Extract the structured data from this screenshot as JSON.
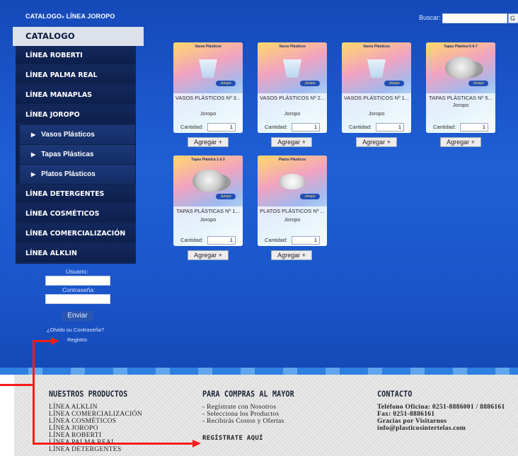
{
  "header": {
    "site_title_prefix": "CATALOGO",
    "site_title_sep": "»",
    "site_title_rest": " LÍNEA JOROPO",
    "search_label": "Buscar:",
    "search_value": "",
    "search_button": "G"
  },
  "sidebar": {
    "title": "CATALOGO",
    "items": [
      {
        "label": "LÍNEA ROBERTI",
        "sub": false
      },
      {
        "label": "LÍNEA PALMA REAL",
        "sub": false
      },
      {
        "label": "LÍNEA MANAPLAS",
        "sub": false
      },
      {
        "label": "LÍNEA JOROPO",
        "sub": false
      },
      {
        "label": "Vasos Plásticos",
        "sub": true
      },
      {
        "label": "Tapas Plásticas",
        "sub": true
      },
      {
        "label": "Platos Plásticos",
        "sub": true
      },
      {
        "label": "LÍNEA DETERGENTES",
        "sub": false
      },
      {
        "label": "LÍNEA COSMÉTICOS",
        "sub": false
      },
      {
        "label": "LÍNEA COMERCIALIZACIÓN",
        "sub": false
      },
      {
        "label": "LÍNEA ALKLIN",
        "sub": false
      }
    ]
  },
  "login": {
    "user_label": "Usuario:",
    "pass_label": "Contraseña:",
    "user_value": "",
    "pass_value": "",
    "send_button": "Enviar",
    "forgot_link": "¿Olvido su Contraseña?",
    "register_link": "Registro"
  },
  "products": [
    {
      "name": "VASOS PLÁSTICOS Nº 3...",
      "brand": "Joropo",
      "qty_label": "Cantidad:",
      "qty": "1",
      "add_button": "Agregar +",
      "thumb_title": "Vasos Plásticos",
      "thumb_brand": "Joropo",
      "thumb_kind": "cup"
    },
    {
      "name": "VASOS PLÁSTICOS Nº 2...",
      "brand": "Joropo",
      "qty_label": "Cantidad:",
      "qty": "1",
      "add_button": "Agregar +",
      "thumb_title": "Vasos Plásticos",
      "thumb_brand": "Joropo",
      "thumb_kind": "cup"
    },
    {
      "name": "VASOS PLÁSTICOS Nº 1...",
      "brand": "Joropo",
      "qty_label": "Cantidad:",
      "qty": "1",
      "add_button": "Agregar +",
      "thumb_title": "Vasos Plásticos",
      "thumb_brand": "Joropo",
      "thumb_kind": "cup"
    },
    {
      "name": "TAPAS PLÁSTICAS Nº 5...",
      "brand": "Joropo",
      "qty_label": "Cantidad:",
      "qty": "1",
      "add_button": "Agregar +",
      "thumb_title": "Tapas Plástica 5-6-7",
      "thumb_brand": "Joropo",
      "thumb_kind": "lid"
    },
    {
      "name": "TAPAS PLÁSTICAS Nº 1...",
      "brand": "Joropo",
      "qty_label": "Cantidad:",
      "qty": "1",
      "add_button": "Agregar +",
      "thumb_title": "Tapas Plástica 1-2-3",
      "thumb_brand": "Joropo",
      "thumb_kind": "lid"
    },
    {
      "name": "PLATOS PLÁSTICOS Nº ...",
      "brand": "Joropo",
      "qty_label": "Cantidad:",
      "qty": "1",
      "add_button": "Agregar +",
      "thumb_title": "Platos Plásticos",
      "thumb_brand": "Joropo",
      "thumb_kind": "plate"
    }
  ],
  "footer": {
    "products_title": "NUESTROS PRODUCTOS",
    "products_lines": [
      "LÍNEA ALKLIN",
      "LÍNEA COMERCIALIZACIÓN",
      "LÍNEA COSMÉTICOS",
      "LÍNEA JOROPO",
      "LÍNEA ROBERTI",
      "LÍNEA PALMA REAL",
      "LÍNEA DETERGENTES"
    ],
    "wholesale_title": "PARA COMPRAS AL MAYOR",
    "wholesale_lines": [
      "- Regístrate con Nosotros",
      "- Selecciona los Productos",
      "- Recibirás Costos y Ofertas"
    ],
    "register_here": "REGÍSTRATE AQUÍ",
    "contact_title": "CONTACTO",
    "contact_lines": [
      "Teléfono Oficina: 0251-8886001 / 8886161",
      "Fax: 0251-8886161",
      "Gracias por Visitarnos",
      "info@plasticosintertelas.com"
    ]
  },
  "colors": {
    "page_blue": "#1f5fd6",
    "sidebar_navy": "#0d1f4b",
    "annotation_red": "#ff1a1a"
  }
}
